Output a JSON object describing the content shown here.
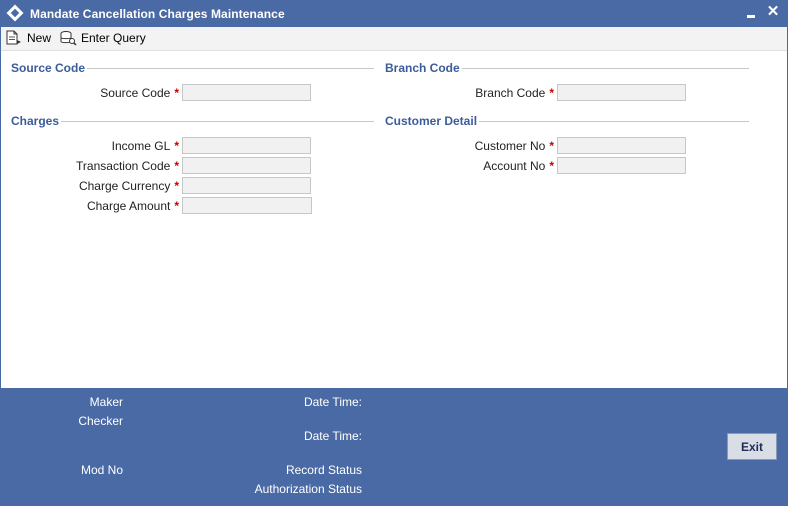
{
  "window": {
    "title": "Mandate Cancellation Charges Maintenance",
    "close_glyph": "✕"
  },
  "toolbar": {
    "new_label": "New",
    "enter_query_label": "Enter Query"
  },
  "sections": {
    "source_code": "Source Code",
    "branch_code": "Branch Code",
    "charges": "Charges",
    "customer_detail": "Customer Detail"
  },
  "fields": {
    "source_code": {
      "label": "Source Code",
      "value": ""
    },
    "branch_code": {
      "label": "Branch Code",
      "value": ""
    },
    "income_gl": {
      "label": "Income GL",
      "value": ""
    },
    "transaction_code": {
      "label": "Transaction Code",
      "value": ""
    },
    "charge_currency": {
      "label": "Charge Currency",
      "value": ""
    },
    "charge_amount": {
      "label": "Charge Amount",
      "value": ""
    },
    "customer_no": {
      "label": "Customer No",
      "value": ""
    },
    "account_no": {
      "label": "Account No",
      "value": ""
    }
  },
  "required_marker": "*",
  "footer": {
    "maker": "Maker",
    "checker": "Checker",
    "date_time_1": "Date Time:",
    "date_time_2": "Date Time:",
    "mod_no": "Mod No",
    "record_status": "Record Status",
    "authorization_status": "Authorization Status",
    "exit_label": "Exit"
  },
  "colors": {
    "title_bar": "#4a6aa5",
    "section_header": "#3b5c9a",
    "required": "#cc0000",
    "footer": "#4a6aa5"
  },
  "icons": {
    "app": "diamond-icon",
    "new": "new-document-icon",
    "enter_query": "query-icon",
    "minimize": "minimize-icon",
    "close": "close-icon"
  }
}
